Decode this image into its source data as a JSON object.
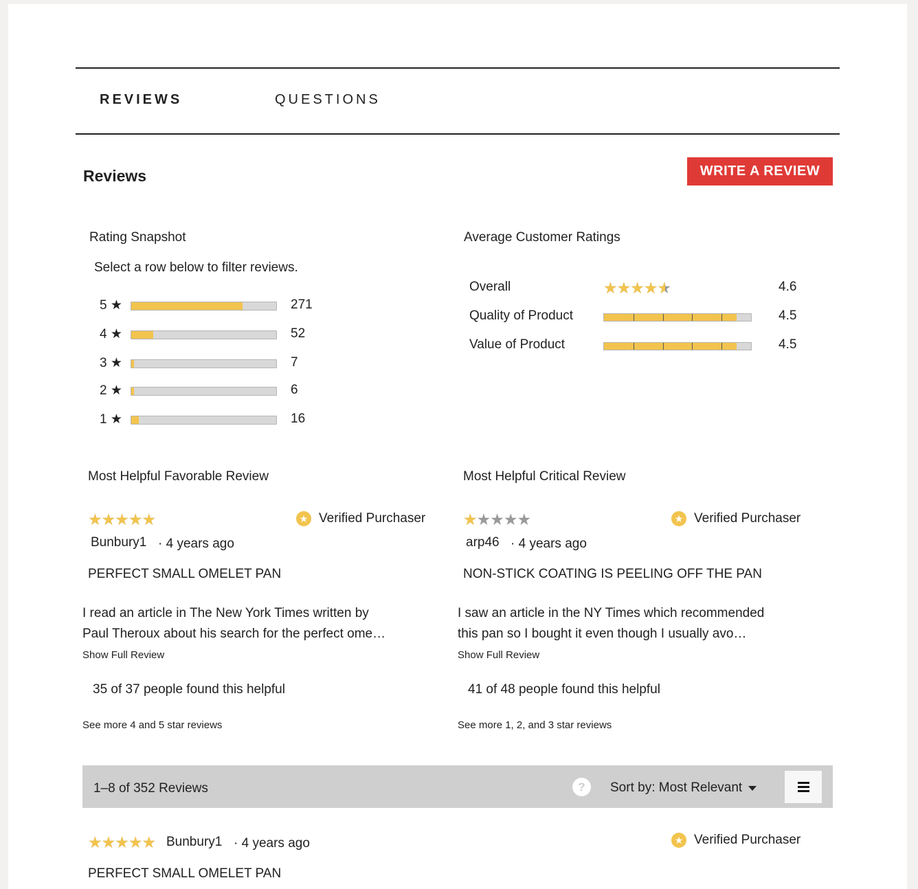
{
  "tabs": [
    {
      "label": "REVIEWS",
      "active": true
    },
    {
      "label": "QUESTIONS",
      "active": false
    }
  ],
  "section_title": "Reviews",
  "write_review_label": "WRITE A REVIEW",
  "rating_snapshot": {
    "title": "Rating Snapshot",
    "subtitle": "Select a row below to filter reviews.",
    "rows": [
      {
        "label": "5 ★",
        "count": "271",
        "fraction": 0.77
      },
      {
        "label": "4 ★",
        "count": "52",
        "fraction": 0.15
      },
      {
        "label": "3 ★",
        "count": "7",
        "fraction": 0.02
      },
      {
        "label": "2 ★",
        "count": "6",
        "fraction": 0.02
      },
      {
        "label": "1 ★",
        "count": "16",
        "fraction": 0.05
      }
    ]
  },
  "average_ratings": {
    "title": "Average Customer Ratings",
    "overall": {
      "label": "Overall",
      "value": "4.6",
      "stars": 4.6
    },
    "rows": [
      {
        "label": "Quality of Product",
        "value": "4.5",
        "fraction": 0.9
      },
      {
        "label": "Value of Product",
        "value": "4.5",
        "fraction": 0.9
      }
    ]
  },
  "favorable": {
    "heading": "Most Helpful Favorable Review",
    "rating": 5,
    "verified": "Verified Purchaser",
    "author": "Bunbury1",
    "ago": "· 4 years ago",
    "title": "PERFECT SMALL OMELET PAN",
    "line1": "I read an article in The New York Times written by",
    "line2": "Paul Theroux about his search for the perfect ome…",
    "show_full": "Show Full Review",
    "helpful": "35 of 37 people found this helpful",
    "see_more": "See more 4 and 5 star reviews"
  },
  "critical": {
    "heading": "Most Helpful Critical Review",
    "rating": 1,
    "verified": "Verified Purchaser",
    "author": "arp46",
    "ago": "· 4 years ago",
    "title": "NON-STICK COATING IS PEELING OFF THE PAN",
    "line1": "I saw an article in the NY Times which recommended",
    "line2": "this pan so I bought it even though I usually avo…",
    "show_full": "Show Full Review",
    "helpful": "41 of 48 people found this helpful",
    "see_more": "See more 1, 2, and 3 star reviews"
  },
  "toolbar": {
    "count": "1–8 of 352 Reviews",
    "help": "?",
    "sort": "Sort by: Most Relevant",
    "menu_icon": "hamburger-menu-icon"
  },
  "first_review": {
    "rating": 5,
    "author": "Bunbury1",
    "ago": "· 4 years ago",
    "verified": "Verified Purchaser",
    "title": "PERFECT SMALL OMELET PAN"
  },
  "colors": {
    "accent_red": "#e03a36",
    "star_gold": "#f2c44e",
    "star_gray": "#9a9a9a",
    "toolbar_gray": "#cfcfcf"
  }
}
